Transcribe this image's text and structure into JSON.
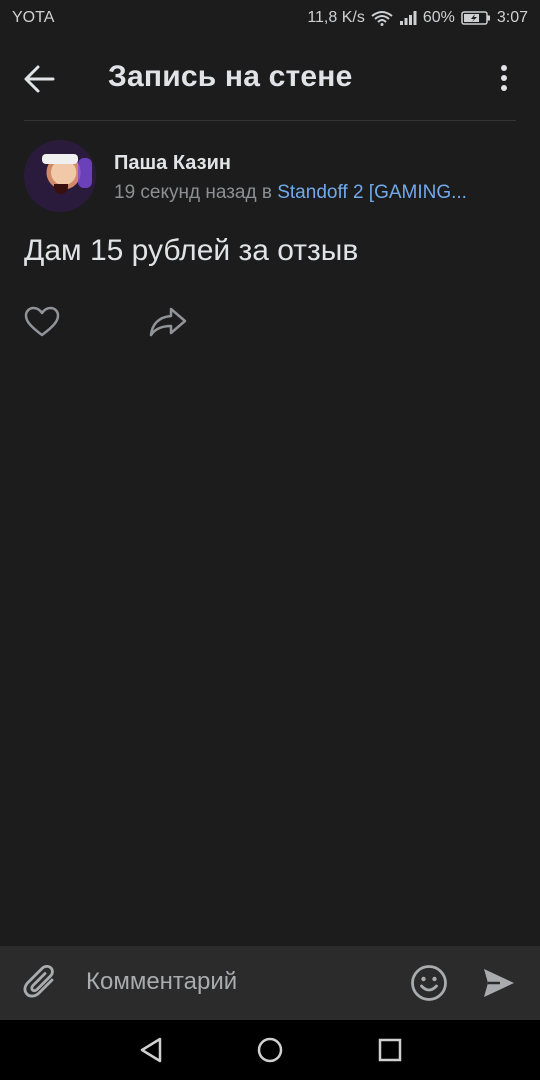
{
  "status_bar": {
    "carrier": "YOTA",
    "network_speed": "11,8 K/s",
    "battery": "60%",
    "time": "3:07"
  },
  "header": {
    "title": "Запись на стене"
  },
  "post": {
    "author": "Паша Казин",
    "time_ago": "19 секунд назад в ",
    "group": "Standoff 2 [GAMING...",
    "text": "Дам 15 рублей за отзыв"
  },
  "comment_bar": {
    "placeholder": "Комментарий"
  },
  "icons": {
    "back": "arrow-left-icon",
    "more": "more-vertical-icon",
    "like": "heart-icon",
    "share": "share-icon",
    "attach": "paperclip-icon",
    "emoji": "smile-icon",
    "send": "send-icon"
  },
  "colors": {
    "background": "#1c1c1c",
    "link": "#71aaeb",
    "comment_bar": "#2b2b2b"
  }
}
